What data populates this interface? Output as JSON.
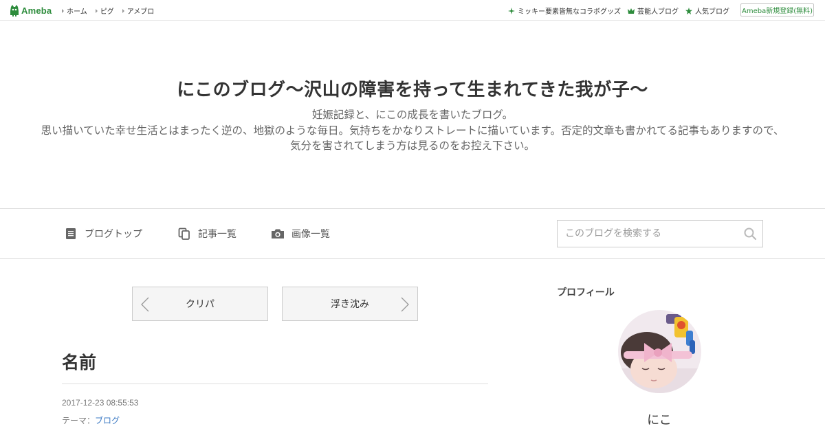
{
  "topbar": {
    "logo_text": "Ameba",
    "left_links": [
      "ホーム",
      "ピグ",
      "アメブロ"
    ],
    "right_links": [
      {
        "icon": "sparkle-icon",
        "label": "ミッキー要素皆無なコラボグッズ"
      },
      {
        "icon": "crown-icon",
        "label": "芸能人ブログ"
      },
      {
        "icon": "star-icon",
        "label": "人気ブログ"
      }
    ],
    "register_label": "Ameba新規登録(無料)"
  },
  "header": {
    "title": "にこのブログ～沢山の障害を持って生まれてきた我が子～",
    "description": [
      "妊娠記録と、にこの成長を書いたブログ。",
      "思い描いていた幸せ生活とはまったく逆の、地獄のような毎日。気持ちをかなりストレートに描いています。否定的文章も書かれてる記事もありますので、",
      "気分を害されてしまう方は見るのをお控え下さい。"
    ]
  },
  "blognav": {
    "items": [
      {
        "icon": "document-icon",
        "label": "ブログトップ"
      },
      {
        "icon": "copy-icon",
        "label": "記事一覧"
      },
      {
        "icon": "camera-icon",
        "label": "画像一覧"
      }
    ],
    "search_placeholder": "このブログを検索する"
  },
  "pager": {
    "prev_label": "クリパ",
    "next_label": "浮き沈み"
  },
  "entry": {
    "title": "名前",
    "date": "2017-12-23 08:55:53",
    "theme_prefix": "テーマ：",
    "theme_link": "ブログ"
  },
  "sidebar": {
    "heading": "プロフィール",
    "name": "にこ"
  },
  "colors": {
    "brand_green": "#2d8c3c",
    "link_blue": "#3a78c3"
  }
}
